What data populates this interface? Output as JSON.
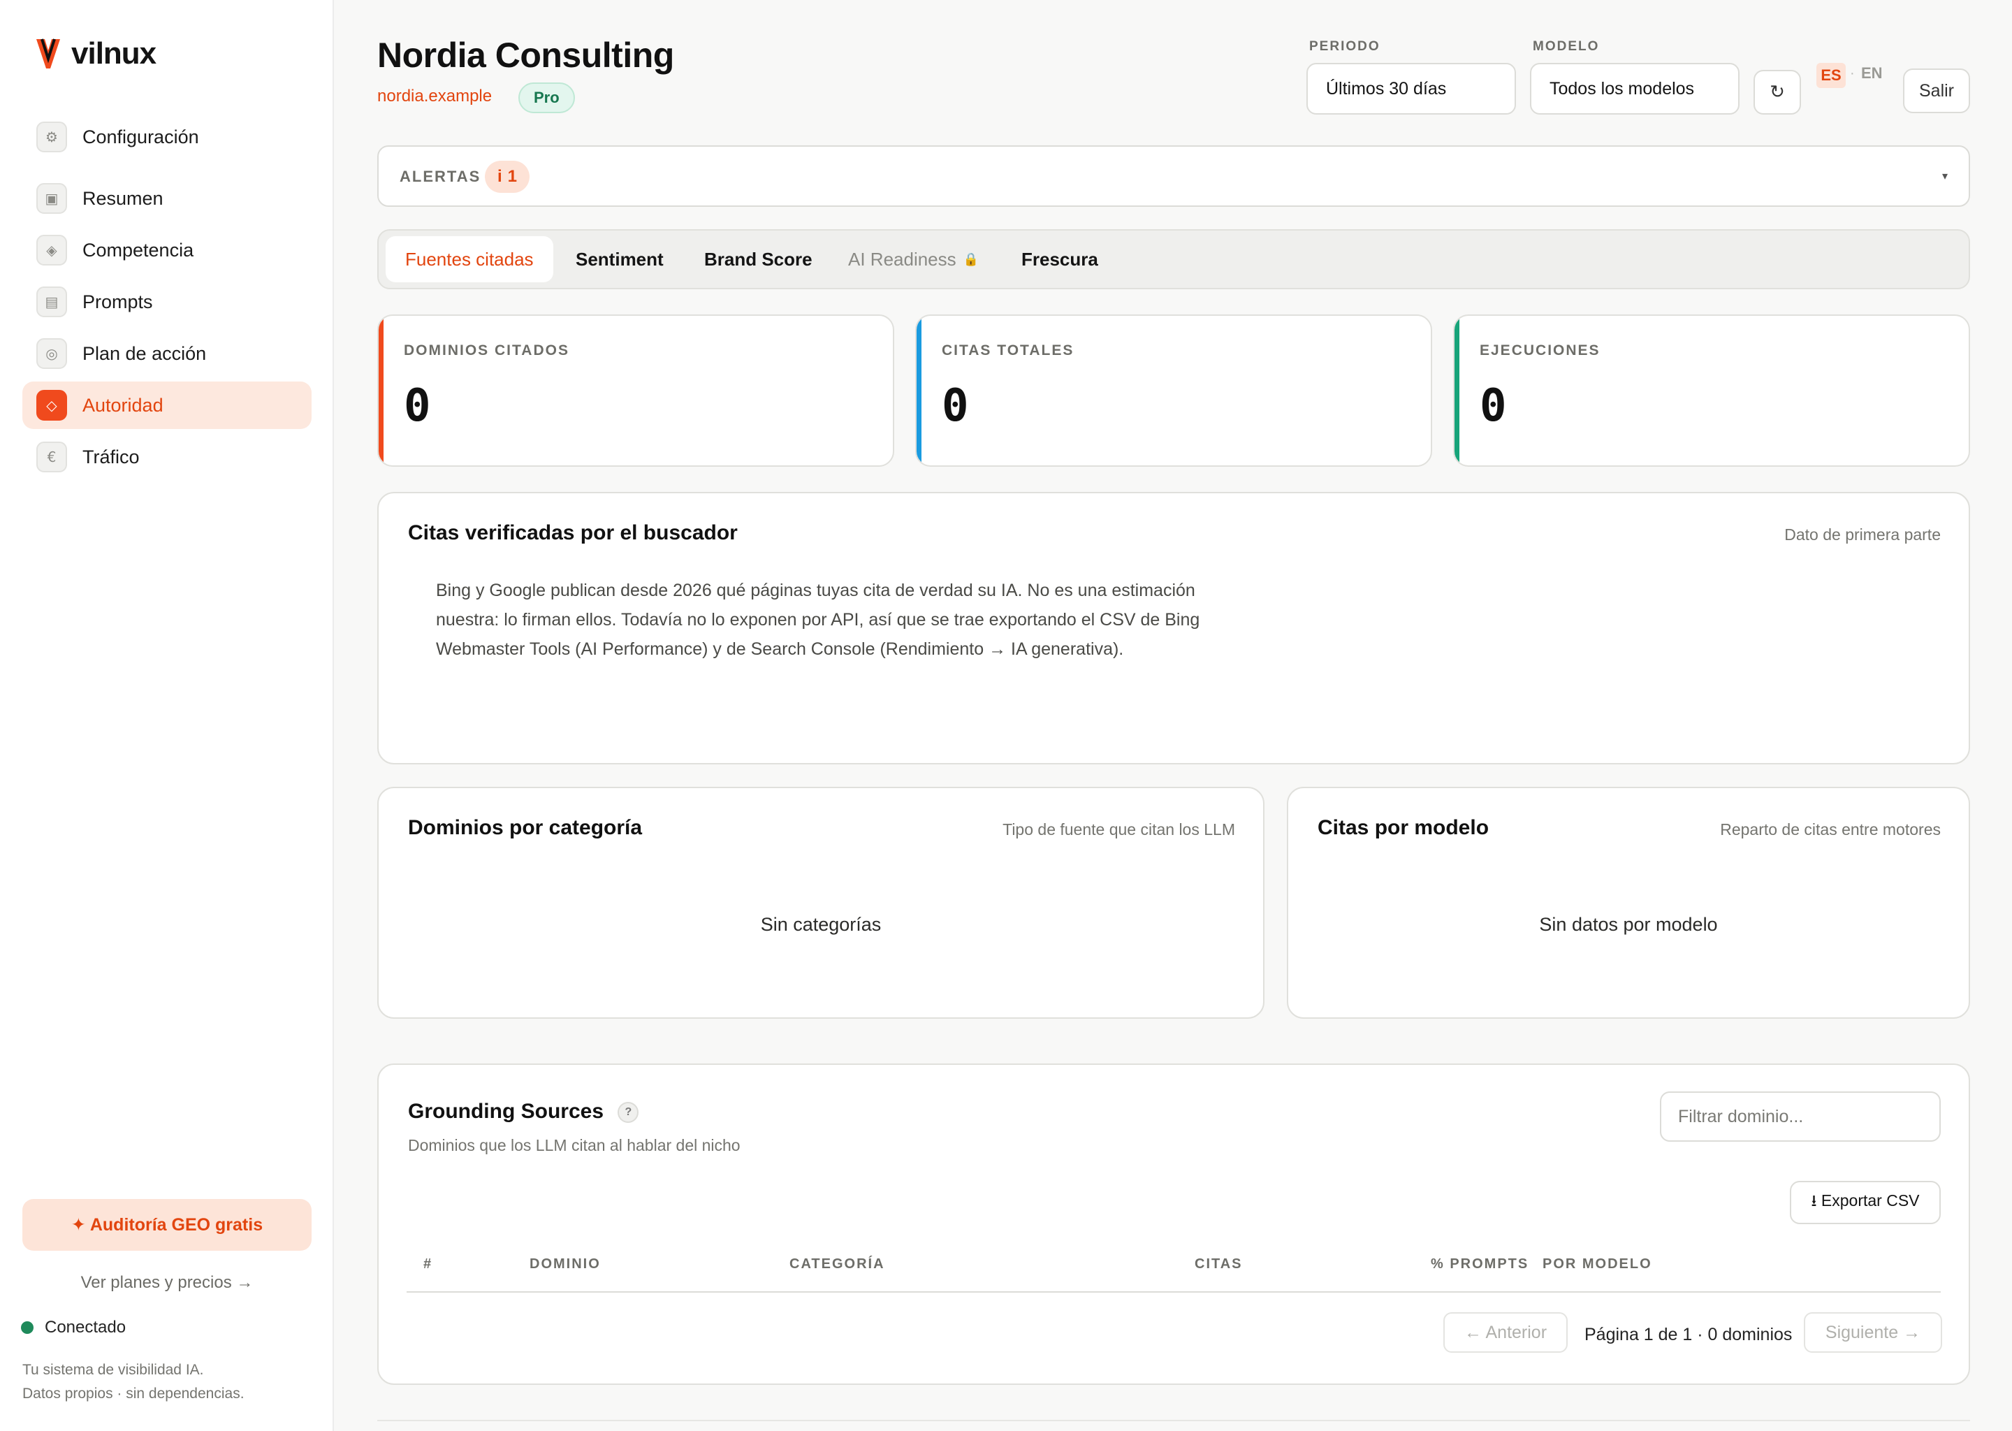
{
  "brand": {
    "name": "vilnux",
    "accent": "#f04a1d"
  },
  "sidebar": {
    "items": [
      {
        "label": "Configuración",
        "icon": "gear-icon",
        "glyph": "⚙"
      },
      {
        "label": "Resumen",
        "icon": "grid-icon",
        "glyph": "▣"
      },
      {
        "label": "Competencia",
        "icon": "diamond-icon",
        "glyph": "◈"
      },
      {
        "label": "Prompts",
        "icon": "list-icon",
        "glyph": "▤"
      },
      {
        "label": "Plan de acción",
        "icon": "target-icon",
        "glyph": "◎"
      },
      {
        "label": "Autoridad",
        "icon": "authority-diamond-icon",
        "glyph": "◇",
        "active": true
      },
      {
        "label": "Tráfico",
        "icon": "euro-icon",
        "glyph": "€"
      }
    ],
    "geo_cta": "✦ Auditoría GEO gratis",
    "plans_link": "Ver planes y precios →",
    "status": "Conectado",
    "tagline_1": "Tu sistema de visibilidad IA.",
    "tagline_2": "Datos propios · sin dependencias."
  },
  "header": {
    "title": "Nordia Consulting",
    "domain": "nordia.example",
    "plan": "Pro",
    "period_label": "PERIODO",
    "period_value": "Últimos 30 días",
    "model_label": "MODELO",
    "model_value": "Todos los modelos",
    "refresh_glyph": "↻",
    "lang_es": "ES",
    "lang_sep": "·",
    "lang_en": "EN",
    "logout": "Salir"
  },
  "alerts": {
    "label": "ALERTAS",
    "icon_glyph": "i",
    "count": "1",
    "chevron": "▾"
  },
  "tabs": [
    {
      "label": "Fuentes citadas",
      "active": true
    },
    {
      "label": "Sentiment"
    },
    {
      "label": "Brand Score"
    },
    {
      "label": "AI Readiness",
      "locked": true,
      "lock_glyph": "🔒"
    },
    {
      "label": "Frescura"
    }
  ],
  "kpis": [
    {
      "label": "DOMINIOS CITADOS",
      "value": "0",
      "color": "#f04a1d"
    },
    {
      "label": "CITAS TOTALES",
      "value": "0",
      "color": "#1a9be0"
    },
    {
      "label": "EJECUCIONES",
      "value": "0",
      "color": "#17a47a"
    }
  ],
  "verified": {
    "title": "Citas verificadas por el buscador",
    "note": "Dato de primera parte",
    "body": "Bing y Google publican desde 2026 qué páginas tuyas cita de verdad su IA. No es una estimación nuestra: lo firman ellos. Todavía no lo exponen por API, así que se trae exportando el CSV de Bing Webmaster Tools (AI Performance) y de Search Console (Rendimiento → IA generativa)."
  },
  "categories": {
    "title": "Dominios por categoría",
    "note": "Tipo de fuente que citan los LLM",
    "empty": "Sin categorías"
  },
  "models": {
    "title": "Citas por modelo",
    "note": "Reparto de citas entre motores",
    "empty": "Sin datos por modelo"
  },
  "grounding": {
    "title": "Grounding Sources",
    "help": "?",
    "subtitle": "Dominios que los LLM citan al hablar del nicho",
    "filter_placeholder": "Filtrar dominio...",
    "export": "⭳ Exportar CSV",
    "columns": [
      "#",
      "DOMINIO",
      "CATEGORÍA",
      "CITAS",
      "% PROMPTS",
      "POR MODELO"
    ],
    "prev": "← Anterior",
    "next": "Siguiente →",
    "page_info": "Página 1 de 1 · 0 dominios"
  }
}
